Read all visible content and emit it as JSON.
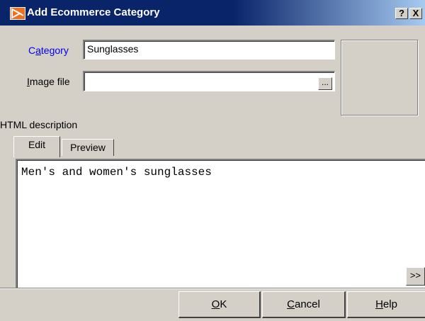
{
  "window": {
    "title": "Add Ecommerce Category",
    "help_label": "?",
    "close_label": "X"
  },
  "form": {
    "category_label_prefix": "C",
    "category_label_mnemonic": "a",
    "category_label_rest": "tegory",
    "category_value": "Sunglasses",
    "image_label_mnemonic": "I",
    "image_label_rest": "mage file",
    "image_value": "",
    "browse_label": "...",
    "html_description_label": "HTML description"
  },
  "tabs": [
    {
      "label": "Edit",
      "active": true
    },
    {
      "label": "Preview",
      "active": false
    }
  ],
  "editor": {
    "content": "Men's and women's sunglasses",
    "expand_label": ">>"
  },
  "buttons": {
    "ok_mnemonic": "O",
    "ok_rest": "K",
    "cancel_mnemonic": "C",
    "cancel_rest": "ancel",
    "help_mnemonic": "H",
    "help_rest": "elp"
  },
  "colors": {
    "titlebar": "#0a246a",
    "face": "#d4d0c8",
    "label_accent": "#0000ee"
  }
}
